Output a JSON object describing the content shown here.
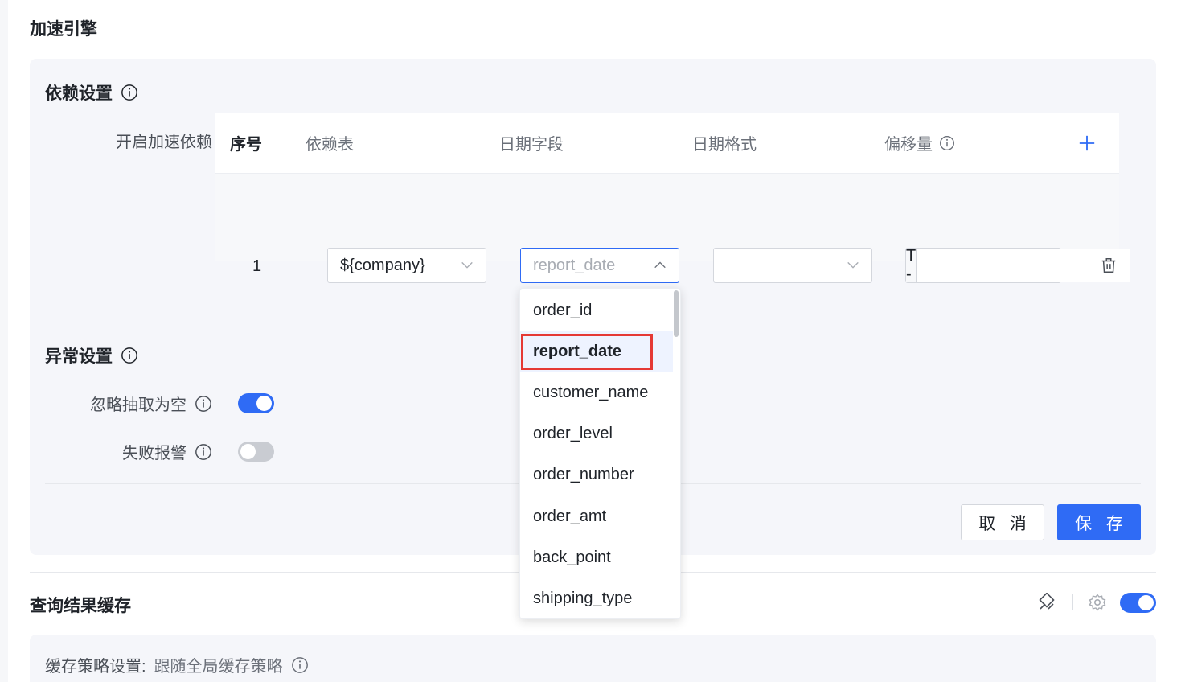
{
  "page_title": "加速引擎",
  "dependency": {
    "title": "依赖设置",
    "enable_label": "开启加速依赖",
    "enable_on": true,
    "table": {
      "headers": {
        "index": "序号",
        "dep_table": "依赖表",
        "date_field": "日期字段",
        "date_format": "日期格式",
        "offset": "偏移量"
      },
      "rows": [
        {
          "index": "1",
          "dep_table": "${company}",
          "date_field_placeholder": "report_date",
          "date_format": "",
          "offset_prefix": "T -",
          "offset_value": ""
        }
      ]
    },
    "date_field_options": [
      "order_id",
      "report_date",
      "customer_name",
      "order_level",
      "order_number",
      "order_amt",
      "back_point",
      "shipping_type"
    ],
    "selected_option": "report_date"
  },
  "exception": {
    "title": "异常设置",
    "ignore_empty_label": "忽略抽取为空",
    "ignore_empty_on": true,
    "fail_alert_label": "失败报警",
    "fail_alert_on": false
  },
  "actions": {
    "cancel": "取 消",
    "save": "保 存"
  },
  "cache": {
    "title": "查询结果缓存",
    "enabled": true,
    "strategy_label": "缓存策略设置:",
    "strategy_value": "跟随全局缓存策略"
  },
  "colors": {
    "primary": "#2f6bf5",
    "highlight": "#e53935"
  }
}
